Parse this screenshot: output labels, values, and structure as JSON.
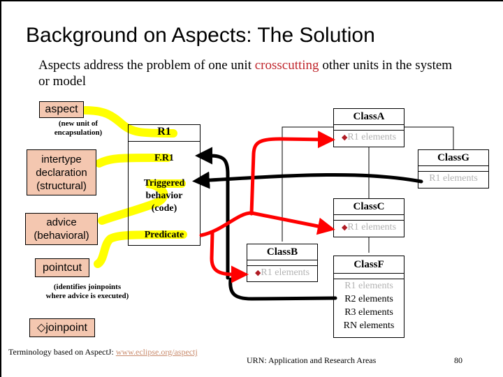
{
  "slide": {
    "title": "Background on Aspects: The Solution",
    "subtitle_before": "Aspects address the problem of one unit ",
    "subtitle_highlight": "crosscutting",
    "subtitle_after": " other units in the system or model",
    "highlight_color": "#c0272d"
  },
  "terms": {
    "aspect": "aspect",
    "aspect_note": "(new unit of encapsulation)",
    "intertype": "intertype declaration (structural)",
    "intertype_lines": [
      "intertype",
      "declaration",
      "(structural)"
    ],
    "advice_lines": [
      "advice",
      "(behavioral)"
    ],
    "pointcut": "pointcut",
    "pointcut_note_lines": [
      "(identifies joinpoints",
      "where advice is executed)"
    ],
    "joinpoint": "◇joinpoint"
  },
  "r1_box": {
    "name": "R1",
    "items": [
      "F.R1",
      "Triggered",
      "behavior",
      "(code)",
      "Predicate"
    ]
  },
  "classes": {
    "a": {
      "name": "ClassA",
      "rows": [
        "R1 elements"
      ]
    },
    "g": {
      "name": "ClassG",
      "rows": [
        "R1 elements"
      ]
    },
    "c": {
      "name": "ClassC",
      "rows": [
        "R1 elements"
      ]
    },
    "b": {
      "name": "ClassB",
      "rows": [
        "R1 elements"
      ]
    },
    "f": {
      "name": "ClassF",
      "rows": [
        "R1 elements",
        "R2 elements",
        "R3 elements",
        "RN elements"
      ]
    }
  },
  "diamond": "◆",
  "colors": {
    "highlight_yellow": "#ffff00",
    "advice_arrow": "#ff0000",
    "structural_arrow": "#000000",
    "term_box": "#f4c7b0",
    "grey_text": "#b3b3b3"
  },
  "footer": {
    "terminology": "Terminology based on AspectJ: ",
    "link": "www.eclipse.org/aspectj",
    "center": "URN: Application and Research Areas",
    "page": "80"
  }
}
